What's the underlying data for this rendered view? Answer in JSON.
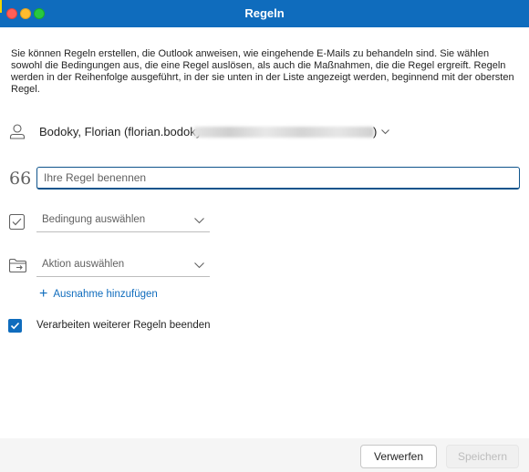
{
  "window": {
    "title": "Regeln"
  },
  "intro_text": "Sie können Regeln erstellen, die Outlook anweisen, wie eingehende E-Mails zu behandeln sind. Sie wählen sowohl die Bedingungen aus, die eine Regel auslösen, als auch die Maßnahmen, die die Regel ergreift. Regeln werden in der Reihenfolge ausgeführt, in der sie unten in der Liste angezeigt werden, beginnend mit der obersten Regel.",
  "account": {
    "name_prefix": "Bodoky, Florian (florian.bodoky",
    "name_suffix": ")",
    "icons": [
      "person-icon",
      "chevron-down-icon"
    ]
  },
  "rule_name": {
    "value": "",
    "placeholder": "Ihre Regel benennen",
    "icon": "quote-icon"
  },
  "condition": {
    "label": "Bedingung auswählen",
    "icon": "checkbox-icon"
  },
  "action": {
    "label": "Aktion auswählen",
    "icon": "folder-move-icon"
  },
  "add_exception": {
    "label": "Ausnahme hinzufügen",
    "icon": "plus-icon"
  },
  "stop_processing": {
    "label": "Verarbeiten weiterer Regeln beenden",
    "checked": true
  },
  "buttons": {
    "discard": "Verwerfen",
    "save": "Speichern"
  },
  "colors": {
    "accent": "#0f6cbd",
    "titlebar": "#0f6cbd"
  }
}
